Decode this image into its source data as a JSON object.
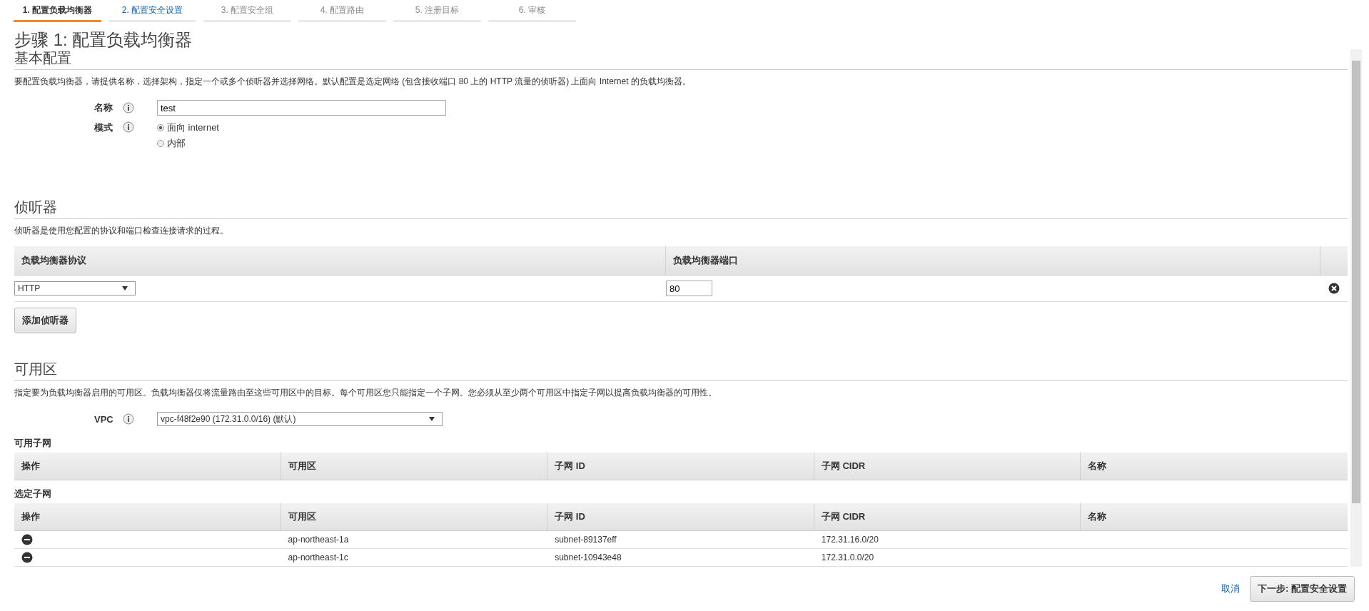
{
  "steps": [
    {
      "label": "1. 配置负载均衡器",
      "selected": true,
      "enabled": true
    },
    {
      "label": "2. 配置安全设置",
      "selected": false,
      "enabled": true
    },
    {
      "label": "3. 配置安全组",
      "selected": false,
      "enabled": false
    },
    {
      "label": "4. 配置路由",
      "selected": false,
      "enabled": false
    },
    {
      "label": "5. 注册目标",
      "selected": false,
      "enabled": false
    },
    {
      "label": "6. 审核",
      "selected": false,
      "enabled": false
    }
  ],
  "page_title": "步骤 1: 配置负载均衡器",
  "basic": {
    "heading": "基本配置",
    "description": "要配置负载均衡器，请提供名称，选择架构，指定一个或多个侦听器并选择网络。默认配置是选定网络 (包含接收端口 80 上的 HTTP 流量的侦听器) 上面向 Internet 的负载均衡器。",
    "name": {
      "label": "名称",
      "value": "test"
    },
    "scheme": {
      "label": "模式",
      "options": [
        {
          "label": "面向 internet",
          "selected": true
        },
        {
          "label": "内部",
          "selected": false
        }
      ]
    }
  },
  "listeners": {
    "heading": "侦听器",
    "description": "侦听器是使用您配置的协议和端口检查连接请求的过程。",
    "columns": [
      "负载均衡器协议",
      "负载均衡器端口"
    ],
    "rows": [
      {
        "protocol": "HTTP",
        "port": "80"
      }
    ],
    "add_button": "添加侦听器"
  },
  "availability_zones": {
    "heading": "可用区",
    "description": "指定要为负载均衡器启用的可用区。负载均衡器仅将流量路由至这些可用区中的目标。每个可用区您只能指定一个子网。您必须从至少两个可用区中指定子网以提高负载均衡器的可用性。",
    "vpc": {
      "label": "VPC",
      "value": "vpc-f48f2e90 (172.31.0.0/16) (默认)"
    },
    "available_subnets": {
      "title": "可用子网",
      "columns": [
        "操作",
        "可用区",
        "子网 ID",
        "子网 CIDR",
        "名称"
      ]
    },
    "selected_subnets": {
      "title": "选定子网",
      "columns": [
        "操作",
        "可用区",
        "子网 ID",
        "子网 CIDR",
        "名称"
      ],
      "rows": [
        {
          "zone": "ap-northeast-1a",
          "subnet_id": "subnet-89137eff",
          "cidr": "172.31.16.0/20"
        },
        {
          "zone": "ap-northeast-1c",
          "subnet_id": "subnet-10943e48",
          "cidr": "172.31.0.0/20"
        }
      ]
    }
  },
  "footer": {
    "cancel": "取消",
    "next": "下一步: 配置安全设置"
  }
}
